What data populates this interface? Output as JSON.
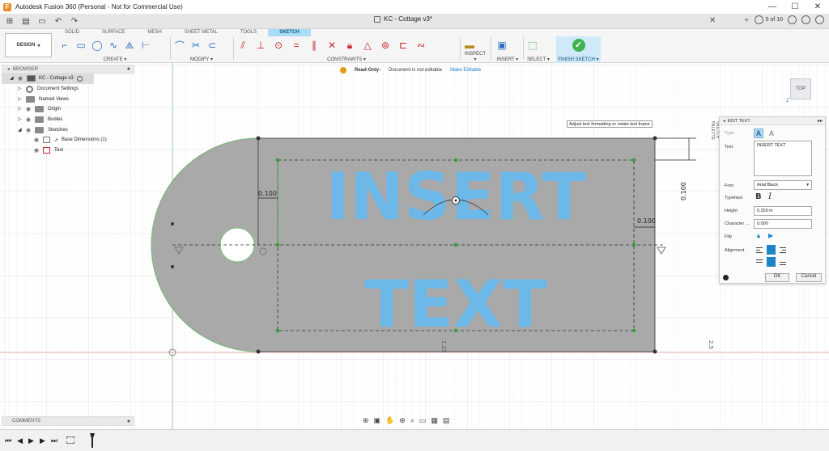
{
  "titlebar": {
    "title": "Autodesk Fusion 360 (Personal - Not for Commercial Use)",
    "controls": [
      "—",
      "☐",
      "✕"
    ]
  },
  "qabar": {
    "doc_title": "KC - Cottage v3*",
    "jobs": "5 of 10"
  },
  "ribbon": {
    "workspace": "DESIGN",
    "tabs": [
      "SOLID",
      "SURFACE",
      "MESH",
      "SHEET METAL",
      "TOOLS",
      "SKETCH"
    ],
    "active_tab": "SKETCH",
    "groups": {
      "create": "CREATE ▾",
      "modify": "MODIFY ▾",
      "constraints": "CONSTRAINTS ▾",
      "inspect": "INSPECT ▾",
      "insert": "INSERT ▾",
      "select": "SELECT ▾",
      "finish": "FINISH SKETCH ▾"
    }
  },
  "browser": {
    "header": "BROWSER",
    "items": [
      {
        "label": "KC - Cottage v3"
      },
      {
        "label": "Document Settings"
      },
      {
        "label": "Named Views"
      },
      {
        "label": "Origin"
      },
      {
        "label": "Bodies"
      },
      {
        "label": "Sketches"
      },
      {
        "label": "Base Dimensions (1)"
      },
      {
        "label": "Text"
      }
    ]
  },
  "banner": {
    "label": "Read-Only:",
    "message": "Document is not editable",
    "action": "Make Editable"
  },
  "viewcube": {
    "face": "TOP",
    "axis": "Z"
  },
  "tooltip": "Adjust text formatting or rotate text frame",
  "palette_tab": "SKETCH PALETTE",
  "canvas": {
    "text_line1": "INSERT",
    "text_line2": "TEXT",
    "dims": {
      "left": "0.100",
      "right": "0.100",
      "top_right": "0.100",
      "bottom": "1.25",
      "edge": "2.5"
    },
    "text_color": "#6cb8e8",
    "plate_color": "#a9a9a9"
  },
  "edit_text": {
    "header": "EDIT TEXT",
    "type_label": "Type",
    "text_label": "Text",
    "text_value": "INSERT TEXT",
    "font_label": "Font",
    "font_value": "Arial Black",
    "typeface_label": "Typeface",
    "bold_glyph": "B",
    "italic_glyph": "I",
    "height_label": "Height",
    "height_value": "0.250 in",
    "character_label": "Character ...",
    "character_value": "0.000",
    "flip_label": "Flip",
    "alignment_label": "Alignment",
    "ok": "OK",
    "cancel": "Cancel"
  },
  "comments": {
    "header": "COMMENTS"
  },
  "timeline": {
    "controls": [
      "⏮",
      "◀",
      "▶",
      "▶",
      "⏭"
    ]
  }
}
